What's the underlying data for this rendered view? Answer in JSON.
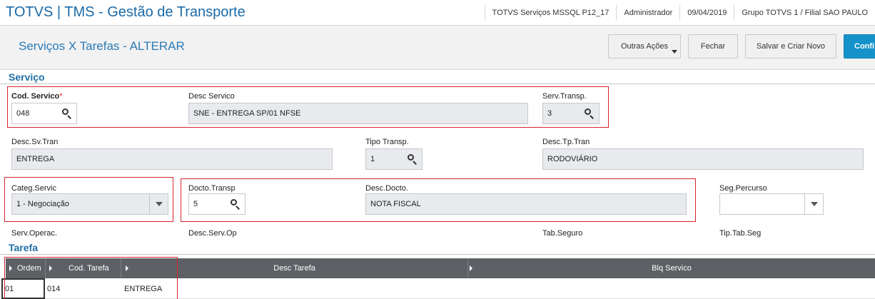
{
  "header": {
    "app_title": "TOTVS | TMS - Gestão de Transporte",
    "environment": "TOTVS Serviços MSSQL P12_17",
    "user": "Administrador",
    "date": "09/04/2019",
    "branch": "Grupo TOTVS 1 / Filial SAO PAULO"
  },
  "page": {
    "title": "Serviços X Tarefas - ALTERAR"
  },
  "toolbar": {
    "more_actions_label": "Outras Ações",
    "close_label": "Fechar",
    "save_new_label": "Salvar e Criar Novo",
    "confirm_label": "Confi"
  },
  "servico": {
    "section_title": "Serviço",
    "cod_servico": {
      "label": "Cod. Servico",
      "required_mark": "*",
      "value": "048"
    },
    "desc_servico": {
      "label": "Desc Servico",
      "value": "SNE - ENTREGA SP/01 NFSE"
    },
    "serv_transp": {
      "label": "Serv.Transp.",
      "value": "3"
    },
    "desc_sv_tran": {
      "label": "Desc.Sv.Tran",
      "value": "ENTREGA"
    },
    "tipo_transp": {
      "label": "Tipo Transp.",
      "value": "1"
    },
    "desc_tp_tran": {
      "label": "Desc.Tp.Tran",
      "value": "RODOVIÁRIO"
    },
    "categ_servic": {
      "label": "Categ.Servic",
      "value": "1 - Negociação"
    },
    "docto_transp": {
      "label": "Docto.Transp",
      "value": "5"
    },
    "desc_docto": {
      "label": "Desc.Docto.",
      "value": "NOTA FISCAL"
    },
    "seg_percurso": {
      "label": "Seg.Percurso",
      "value": ""
    },
    "serv_operac": {
      "label": "Serv.Operac."
    },
    "desc_serv_op": {
      "label": "Desc.Serv.Op"
    },
    "tab_seguro": {
      "label": "Tab.Seguro"
    },
    "tip_tab_seg": {
      "label": "Tip.Tab.Seg"
    }
  },
  "tarefa": {
    "section_title": "Tarefa",
    "columns": [
      "Ordem",
      "Cod. Tarefa",
      "Desc Tarefa",
      "Blq Servico"
    ],
    "rows": [
      {
        "ordem": "01",
        "cod_tarefa": "014",
        "desc_tarefa": "ENTREGA",
        "blq_servico": ""
      }
    ]
  },
  "icons": {
    "search": "search-icon",
    "dropdown": "chevron-down-icon",
    "sort": "sort-arrow-icon"
  },
  "colors": {
    "accent": "#1f6fa8",
    "confirm_button": "#1592c9",
    "highlight_box": "#d9232e",
    "grid_header": "#5d6166"
  }
}
